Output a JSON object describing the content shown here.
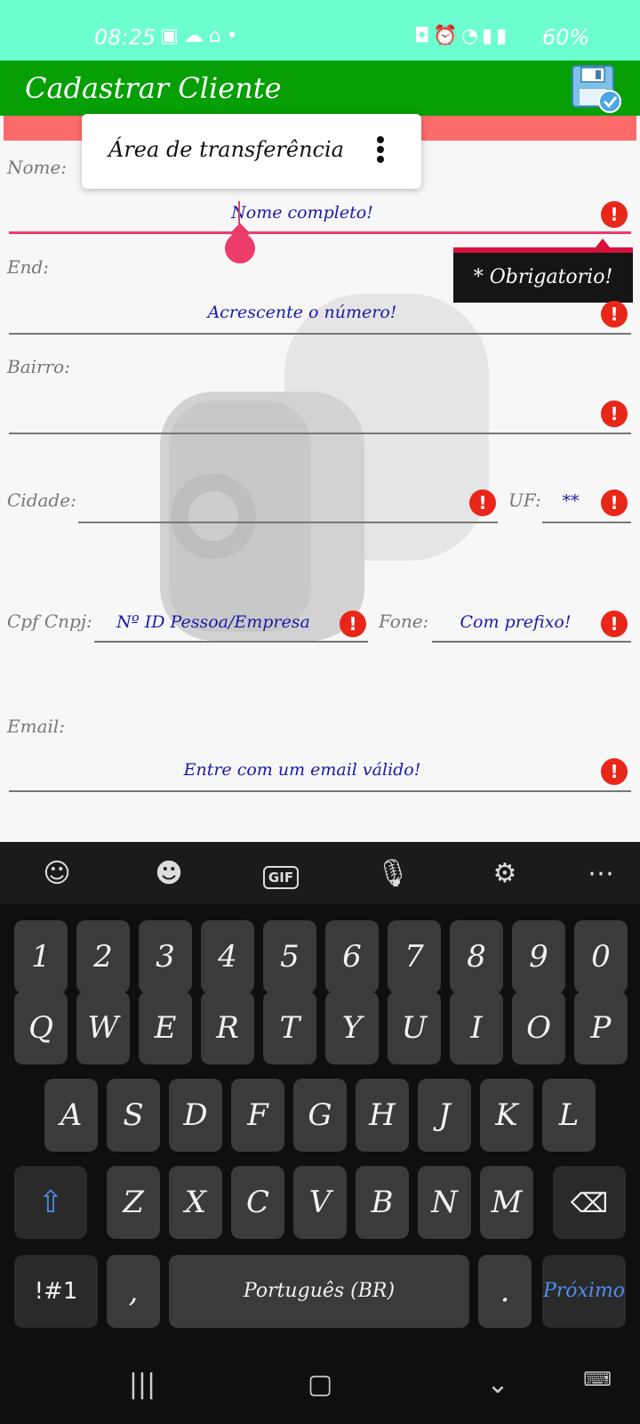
{
  "status_bar": {
    "time": "08:25",
    "battery": "60%",
    "left_icons": [
      "gallery-icon",
      "cloud-icon",
      "camera-icon",
      "dot-icon"
    ],
    "right_icons": [
      "lock-icon",
      "alarm-icon",
      "wifi-icon",
      "signal-icon"
    ]
  },
  "app_bar": {
    "title": "Cadastrar Cliente",
    "save_icon": "save-icon"
  },
  "clipboard_popup": {
    "label": "Área de transferência"
  },
  "tooltip": {
    "text": "* Obrigatorio!"
  },
  "form": {
    "nome": {
      "label": "Nome:",
      "placeholder": "Nome completo!"
    },
    "end": {
      "label": "End:",
      "placeholder": "Acrescente o número!"
    },
    "bairro": {
      "label": "Bairro:",
      "placeholder": ""
    },
    "cidade": {
      "label": "Cidade:",
      "placeholder": ""
    },
    "uf": {
      "label": "UF:",
      "placeholder": "**"
    },
    "cpf": {
      "label": "Cpf Cnpj:",
      "placeholder": "Nº ID Pessoa/Empresa"
    },
    "fone": {
      "label": "Fone:",
      "placeholder": "Com prefixo!"
    },
    "email": {
      "label": "Email:",
      "placeholder": "Entre com um email válido!"
    }
  },
  "keyboard": {
    "toolbar": [
      "emoji-icon",
      "sticker-icon",
      "gif-icon",
      "mic-icon",
      "settings-icon",
      "more-icon"
    ],
    "gif_label": "GIF",
    "row_numbers": [
      "1",
      "2",
      "3",
      "4",
      "5",
      "6",
      "7",
      "8",
      "9",
      "0"
    ],
    "row_q": [
      "Q",
      "W",
      "E",
      "R",
      "T",
      "Y",
      "U",
      "I",
      "O",
      "P"
    ],
    "row_a": [
      "A",
      "S",
      "D",
      "F",
      "G",
      "H",
      "J",
      "K",
      "L"
    ],
    "row_z": [
      "Z",
      "X",
      "C",
      "V",
      "B",
      "N",
      "M"
    ],
    "symbols": "!#1",
    "comma": ",",
    "space": "Português (BR)",
    "period": ".",
    "next": "Próximo"
  },
  "colors": {
    "status_bar": "#6dfecf",
    "app_bar": "#069f06",
    "error": "#e8261a",
    "focus": "#ec3b6b",
    "placeholder": "#1a1aa8"
  }
}
